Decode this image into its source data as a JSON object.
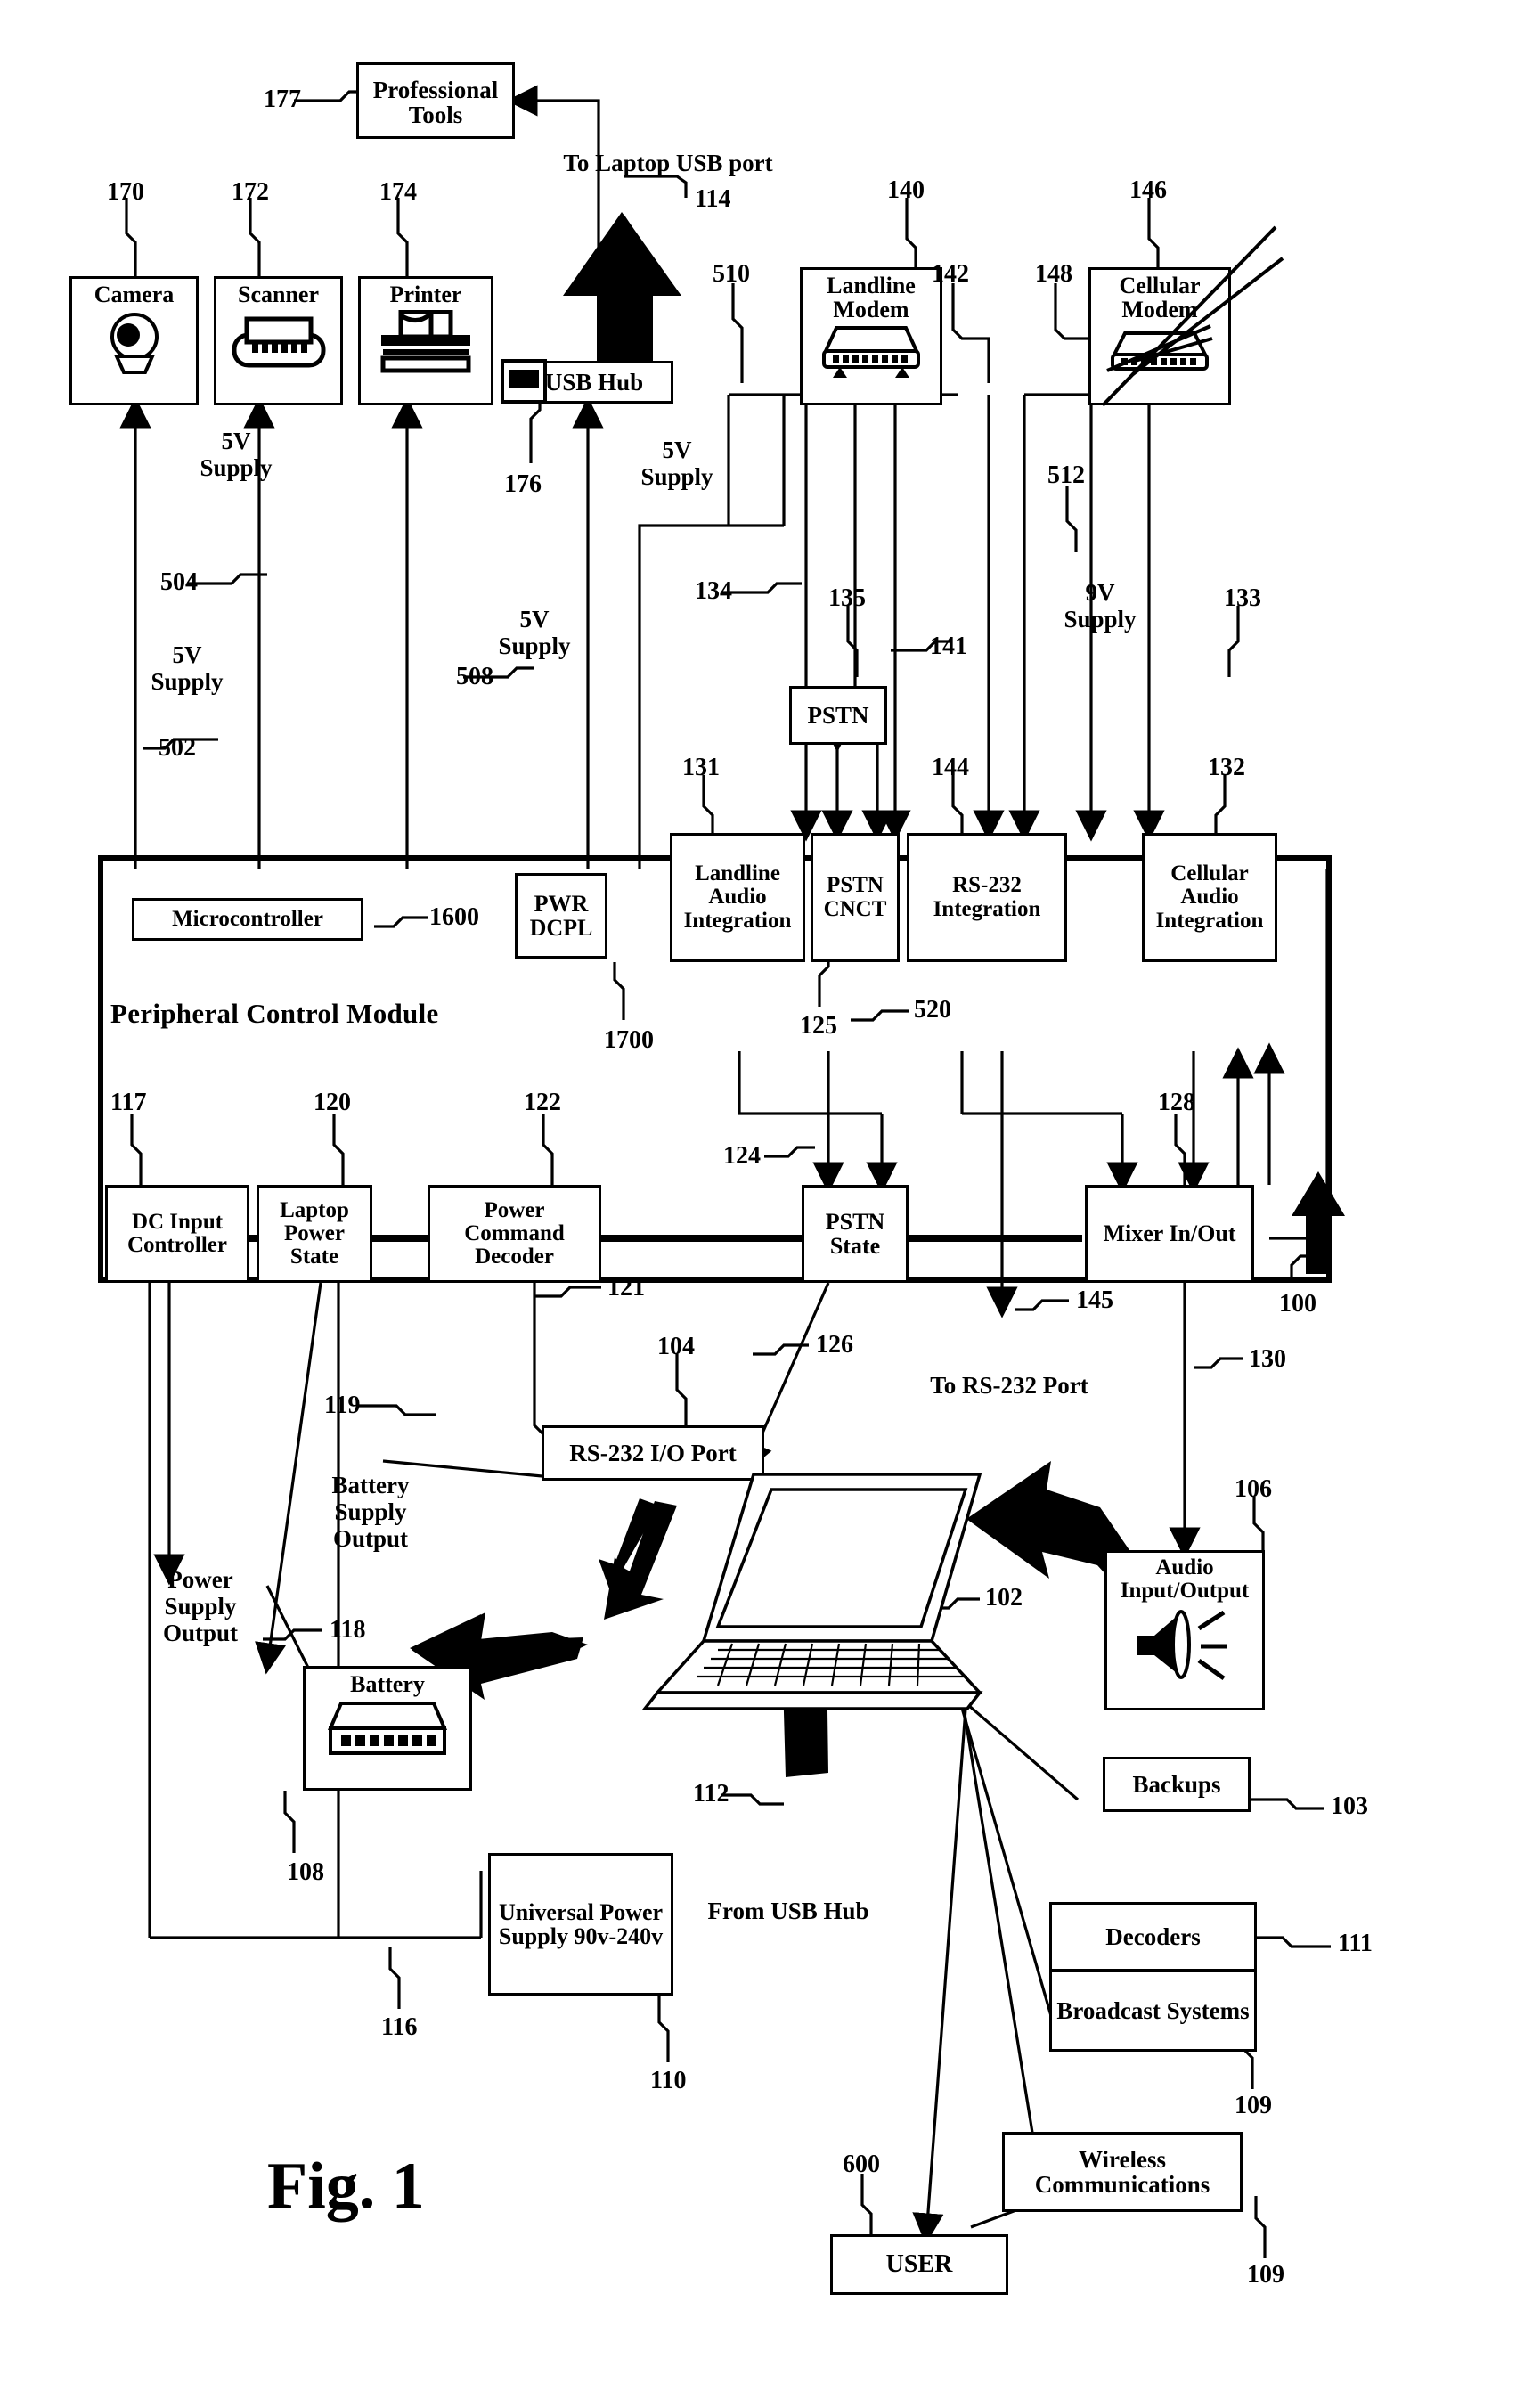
{
  "figure": {
    "label": "Fig. 1"
  },
  "free_text": {
    "to_laptop_usb": "To Laptop USB port",
    "supply_5v_502": "5V\nSupply",
    "supply_5v_504": "5V\nSupply",
    "supply_5v_508": "5V\nSupply",
    "supply_5v_510": "5V\nSupply",
    "supply_9v_512": "9V\nSupply",
    "power_supply_output": "Power\nSupply\nOutput",
    "battery_supply_output": "Battery\nSupply\nOutput",
    "to_rs232_port": "To RS-232 Port",
    "from_usb_hub": "From USB Hub",
    "pcm_title": "Peripheral Control Module"
  },
  "boxes": {
    "professional_tools": "Professional\nTools",
    "camera": "Camera",
    "scanner": "Scanner",
    "printer": "Printer",
    "usb_hub": "USB Hub",
    "landline_modem": "Landline\nModem",
    "cellular_modem": "Cellular\nModem",
    "pstn": "PSTN",
    "microcontroller": "Microcontroller",
    "pwr_dcpl": "PWR\nDCPL",
    "landline_audio_integration": "Landline\nAudio\nIntegration",
    "pstn_cnct": "PSTN\nCNCT",
    "rs232_integration": "RS-232\nIntegration",
    "cellular_audio_integration": "Cellular\nAudio\nIntegration",
    "dc_input_controller": "DC Input\nController",
    "laptop_power_state": "Laptop\nPower\nState",
    "power_command_decoder": "Power\nCommand\nDecoder",
    "pstn_state": "PSTN\nState",
    "mixer_in_out": "Mixer\nIn/Out",
    "rs232_io_port": "RS-232 I/O Port",
    "battery": "Battery",
    "universal_power_supply": "Universal\nPower Supply\n90v-240v",
    "audio_input_output": "Audio\nInput/Output",
    "backups": "Backups",
    "decoders": "Decoders",
    "broadcast_systems": "Broadcast\nSystems",
    "wireless_communications": "Wireless\nCommunications",
    "user": "USER"
  },
  "refs": {
    "r177": "177",
    "r170": "170",
    "r172": "172",
    "r174": "174",
    "r114": "114",
    "r176": "176",
    "r140": "140",
    "r142": "142",
    "r146": "146",
    "r148": "148",
    "r510": "510",
    "r512": "512",
    "r502": "502",
    "r504": "504",
    "r508": "508",
    "r134": "134",
    "r135": "135",
    "r141": "141",
    "r133": "133",
    "r131": "131",
    "r144": "144",
    "r132": "132",
    "r1600": "1600",
    "r1700": "1700",
    "r125": "125",
    "r520": "520",
    "r117": "117",
    "r120": "120",
    "r122": "122",
    "r124": "124",
    "r128": "128",
    "r121": "121",
    "r126": "126",
    "r145": "145",
    "r130": "130",
    "r100": "100",
    "r104": "104",
    "r119": "119",
    "r118": "118",
    "r102": "102",
    "r106": "106",
    "r108": "108",
    "r112": "112",
    "r103": "103",
    "r111": "111",
    "r109a": "109",
    "r109b": "109",
    "r116": "116",
    "r110": "110",
    "r600": "600"
  },
  "colors": {
    "ink": "#000000",
    "paper": "#ffffff"
  }
}
